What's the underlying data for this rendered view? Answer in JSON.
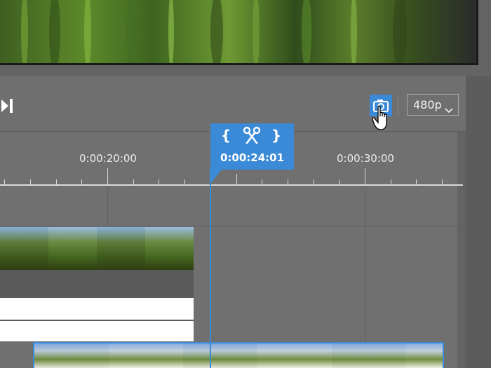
{
  "toolbar": {
    "snapshot_icon": "camera-icon",
    "skip_icon": "skip-to-end-icon",
    "skip_glyph": "▸|",
    "quality": "480p",
    "quality_icon": "chevron-down-icon"
  },
  "ruler": {
    "labels": [
      "0:00:20:00",
      "0:00:30:00"
    ]
  },
  "playhead": {
    "time": "0:00:24:01",
    "mark_in": "{",
    "mark_out": "}",
    "split_icon": "scissors-icon"
  },
  "colors": {
    "accent": "#3a8ad8",
    "background": "#6f6f6f"
  }
}
